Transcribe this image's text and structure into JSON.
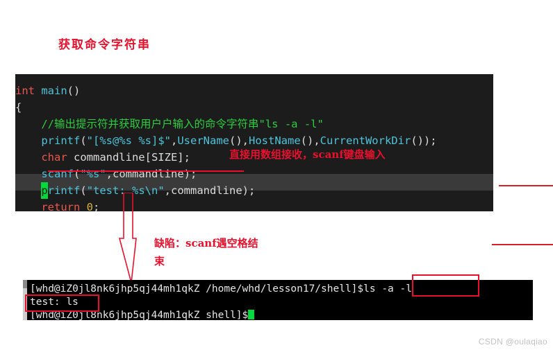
{
  "title": "获取命令字符串",
  "colors": {
    "annotation_red": "#e8112d",
    "code_bg": "#1c1c1c",
    "terminal_bg": "#000000",
    "cursor_green": "#00d93b",
    "comment_green": "#2ecc40",
    "keyword_red": "#e8584f",
    "function_cyan": "#4fc3d9",
    "number_yellow": "#d7b13a"
  },
  "code": {
    "lines": [
      {
        "indent": "",
        "segments": [
          {
            "text": "int",
            "tok": "kw"
          },
          {
            "text": " ",
            "tok": "plain"
          },
          {
            "text": "main",
            "tok": "fn"
          },
          {
            "text": "()",
            "tok": "punc"
          }
        ]
      },
      {
        "indent": "",
        "segments": [
          {
            "text": "{",
            "tok": "plain"
          }
        ]
      },
      {
        "indent": "    ",
        "segments": [
          {
            "text": "//输出提示符并获取用户户输入的命令字符串\"ls -a -l\"",
            "tok": "cmt"
          }
        ]
      },
      {
        "indent": "    ",
        "segments": [
          {
            "text": "printf",
            "tok": "fn"
          },
          {
            "text": "(",
            "tok": "punc"
          },
          {
            "text": "\"[%s@%s %s]$\"",
            "tok": "str"
          },
          {
            "text": ",",
            "tok": "punc"
          },
          {
            "text": "UserName",
            "tok": "fn"
          },
          {
            "text": "(),",
            "tok": "punc"
          },
          {
            "text": "HostName",
            "tok": "fn"
          },
          {
            "text": "(),",
            "tok": "punc"
          },
          {
            "text": "CurrentWorkDir",
            "tok": "fn"
          },
          {
            "text": "());",
            "tok": "punc"
          }
        ]
      },
      {
        "indent": "    ",
        "segments": [
          {
            "text": "char",
            "tok": "kw"
          },
          {
            "text": " commandline[SIZE];",
            "tok": "plain"
          }
        ]
      },
      {
        "indent": "    ",
        "segments": [
          {
            "text": "scanf",
            "tok": "fn"
          },
          {
            "text": "(",
            "tok": "punc"
          },
          {
            "text": "\"%s\"",
            "tok": "str"
          },
          {
            "text": ",commandline);",
            "tok": "punc"
          }
        ]
      },
      {
        "indent": "    ",
        "cursor": "p",
        "segments": [
          {
            "text": "rintf",
            "tok": "fn"
          },
          {
            "text": "(",
            "tok": "punc"
          },
          {
            "text": "\"test: %s\\n\"",
            "tok": "str"
          },
          {
            "text": ",commandline);",
            "tok": "punc"
          }
        ]
      },
      {
        "indent": "    ",
        "segments": [
          {
            "text": "return",
            "tok": "kw"
          },
          {
            "text": " ",
            "tok": "plain"
          },
          {
            "text": "0",
            "tok": "num"
          },
          {
            "text": ";",
            "tok": "punc"
          }
        ]
      },
      {
        "indent": "",
        "segments": [
          {
            "text": "}",
            "tok": "plain"
          }
        ]
      }
    ]
  },
  "annotations": {
    "scanf_input": "直接用数组接收，scanf键盘输入",
    "defect_line1": "缺陷：scanf遇空格结",
    "defect_line2": "束"
  },
  "terminal": {
    "line1_prompt": "[whd@iZ0jl8nk6jhp5qj44mh1qkZ /home/whd/lesson17/shell]$",
    "line1_command": "ls -a -l",
    "line2_output": "test: ls",
    "line3_prompt": "[whd@iZ0jl8nk6jhp5qj44mh1qkZ shell]$"
  },
  "watermark": "CSDN @oulaqiao"
}
